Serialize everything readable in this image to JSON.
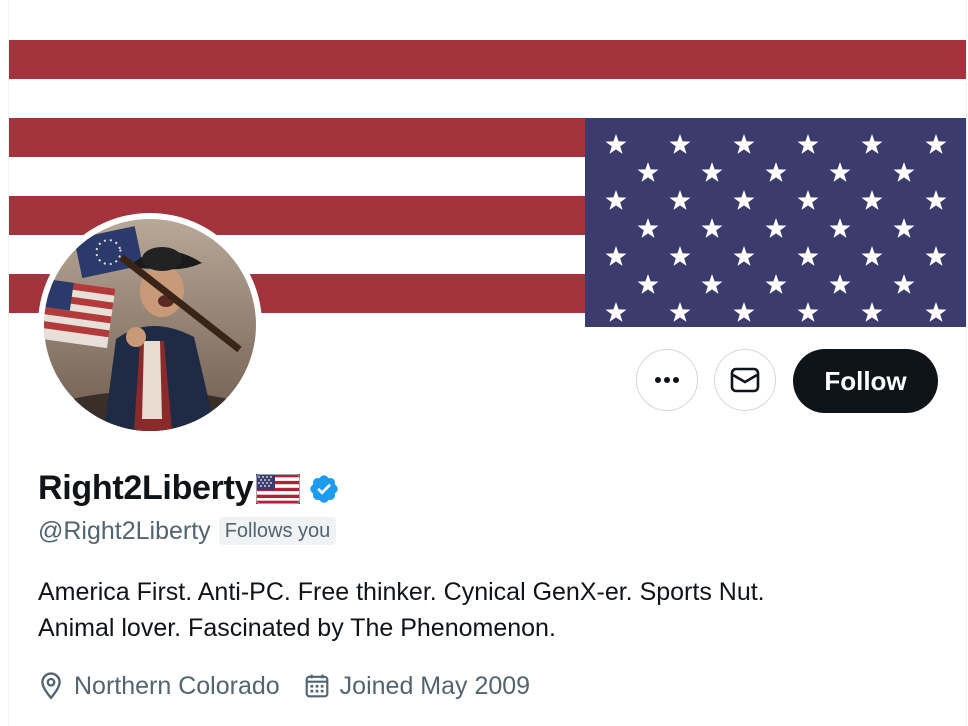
{
  "profile": {
    "display_name": "Right2Liberty",
    "name_emoji": "us-flag-emoji",
    "verified_icon": "verified-badge-icon",
    "handle": "@Right2Liberty",
    "follows_you": "Follows you",
    "bio_line1": "America First. Anti-PC. Free thinker. Cynical GenX-er. Sports Nut.",
    "bio_line2": "Animal lover. Fascinated by The Phenomenon.",
    "location": "Northern Colorado",
    "joined": "Joined May 2009"
  },
  "actions": {
    "more_icon": "more-icon",
    "message_icon": "envelope-icon",
    "follow_label": "Follow"
  },
  "header": {
    "banner": "us-flag-banner",
    "avatar": "colonial-soldier-avatar"
  },
  "colors": {
    "stripe_red": "#a3333d",
    "canton_blue": "#3c3b6e",
    "verified_blue": "#1d9bf0",
    "text_primary": "#0f1419",
    "text_secondary": "#536471",
    "follow_bg": "#0f1419"
  }
}
